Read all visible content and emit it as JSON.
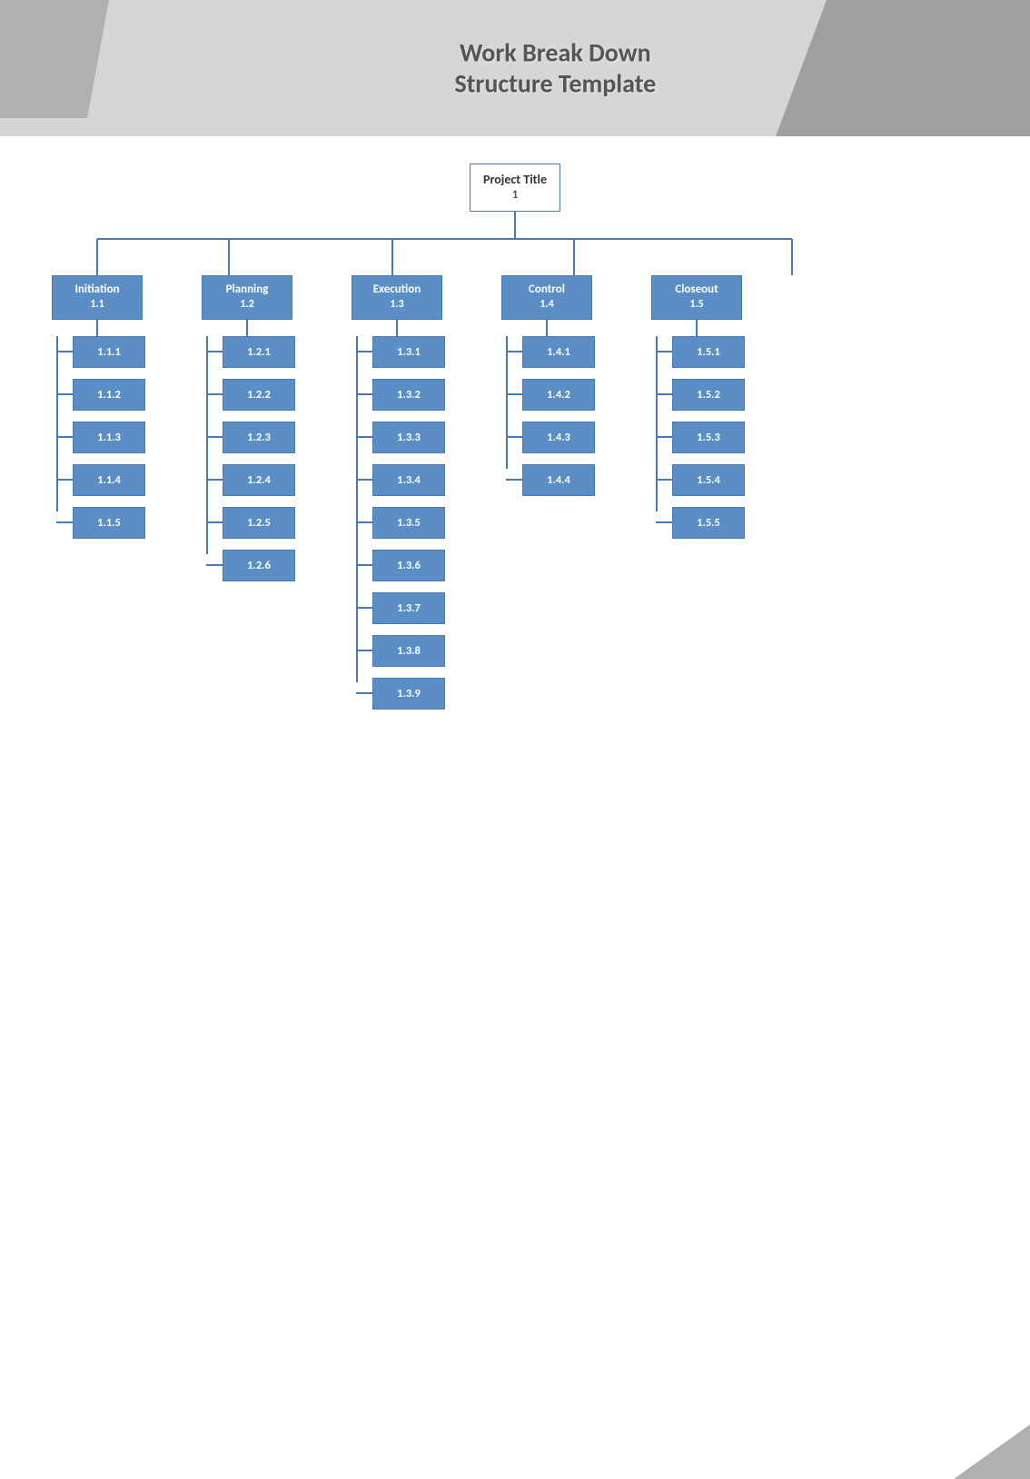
{
  "header": {
    "title_line1": "Work Break Down",
    "title_line2": "Structure Template"
  },
  "root": {
    "label": "Project Title",
    "id": "1"
  },
  "columns": [
    {
      "id": "initiation",
      "label": "Initiation",
      "code": "1.1",
      "leaves": [
        "1.1.1",
        "1.1.2",
        "1.1.3",
        "1.1.4",
        "1.1.5"
      ]
    },
    {
      "id": "planning",
      "label": "Planning",
      "code": "1.2",
      "leaves": [
        "1.2.1",
        "1.2.2",
        "1.2.3",
        "1.2.4",
        "1.2.5",
        "1.2.6"
      ]
    },
    {
      "id": "execution",
      "label": "Execution",
      "code": "1.3",
      "leaves": [
        "1.3.1",
        "1.3.2",
        "1.3.3",
        "1.3.4",
        "1.3.5",
        "1.3.6",
        "1.3.7",
        "1.3.8",
        "1.3.9"
      ]
    },
    {
      "id": "control",
      "label": "Control",
      "code": "1.4",
      "leaves": [
        "1.4.1",
        "1.4.2",
        "1.4.3",
        "1.4.4"
      ]
    },
    {
      "id": "closeout",
      "label": "Closeout",
      "code": "1.5",
      "leaves": [
        "1.5.1",
        "1.5.2",
        "1.5.3",
        "1.5.4",
        "1.5.5"
      ]
    }
  ],
  "colors": {
    "node_bg": "#5b8ec4",
    "node_border": "#4a7ab5",
    "connector": "#4a7ab5",
    "root_bg": "#ffffff",
    "root_text": "#333333",
    "node_text": "#ffffff"
  }
}
